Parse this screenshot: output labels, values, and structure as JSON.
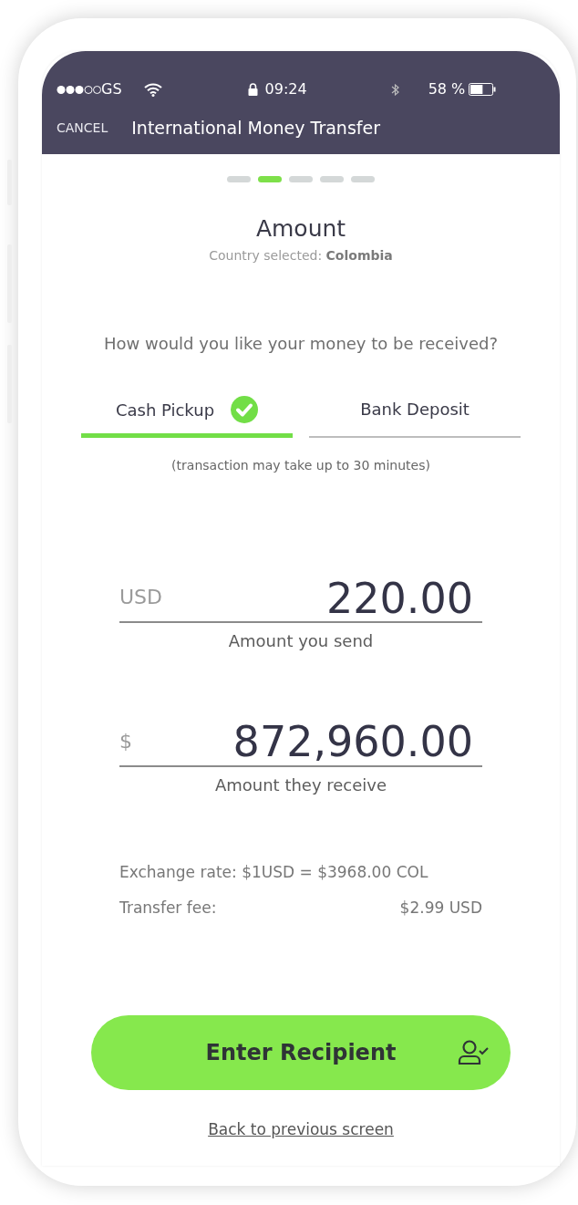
{
  "status_bar": {
    "carrier": "GS",
    "time": "09:24",
    "battery": "58 %"
  },
  "nav": {
    "cancel": "CANCEL",
    "title": "International Money Transfer"
  },
  "steps": [
    {
      "selected": false
    },
    {
      "selected": true
    },
    {
      "selected": false
    },
    {
      "selected": false
    },
    {
      "selected": false
    }
  ],
  "heading": "Amount",
  "country_line": "Country selected: **Colombia**",
  "question": "How would you like your money to be received?",
  "tabs": [
    {
      "label": "Cash Pickup",
      "selected": true
    },
    {
      "label": "Bank Deposit",
      "selected": false
    }
  ],
  "note": "(transaction may take up to 30 minutes)",
  "amounts": [
    {
      "currency": "USD",
      "value": "220.00",
      "label": "Amount you send"
    },
    {
      "currency": "$",
      "value": "872,960.00",
      "label": "Amount they receive"
    }
  ],
  "exchange_rate": "Exchange rate: $1USD = $3968.00 COL",
  "fee": {
    "label": "Transfer fee:",
    "value": "$2.99 USD"
  },
  "primary_button": "Enter Recipient",
  "back_link": "Back to previous screen"
}
